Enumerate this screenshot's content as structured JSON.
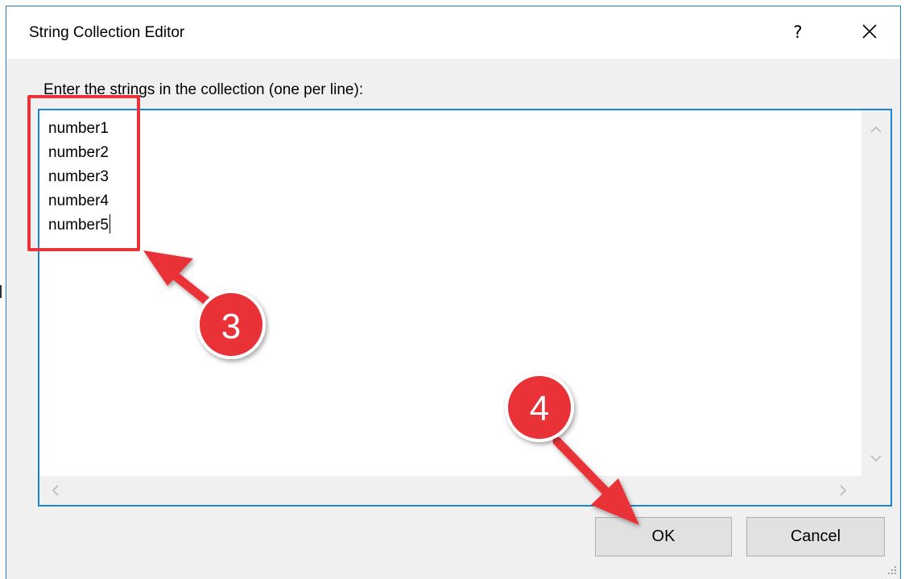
{
  "dialog": {
    "title": "String Collection Editor",
    "help_glyph": "?",
    "prompt": "Enter the strings in the collection (one per line):",
    "lines": [
      "number1",
      "number2",
      "number3",
      "number4",
      "number5"
    ],
    "ok_label": "OK",
    "cancel_label": "Cancel"
  },
  "annotations": {
    "step3_label": "3",
    "step4_label": "4",
    "color": "#e83338"
  },
  "colors": {
    "window_border": "#1883d7",
    "button_face": "#e1e1e1",
    "dialog_bg": "#f0f0f0"
  }
}
